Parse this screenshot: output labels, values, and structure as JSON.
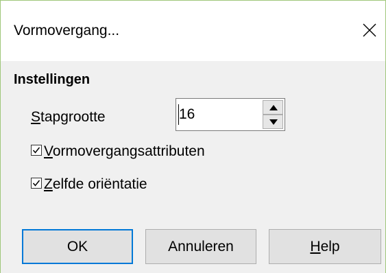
{
  "window": {
    "title": "Vormovergang..."
  },
  "settings": {
    "heading": "Instellingen",
    "step_label_mnemonic": "S",
    "step_label_rest": "tapgrootte",
    "step_value": "16",
    "checkboxes": [
      {
        "mnemonic": "V",
        "rest": "ormovergangsattributen",
        "checked": true
      },
      {
        "mnemonic": "Z",
        "rest": "elfde oriëntatie",
        "checked": true
      }
    ]
  },
  "buttons": {
    "ok_label": "OK",
    "cancel_label": "Annuleren",
    "help_mnemonic": "H",
    "help_rest": "elp"
  },
  "colors": {
    "accent": "#0078d7",
    "window_border": "#9fc77a",
    "dialog_bg": "#f0f0f0"
  }
}
